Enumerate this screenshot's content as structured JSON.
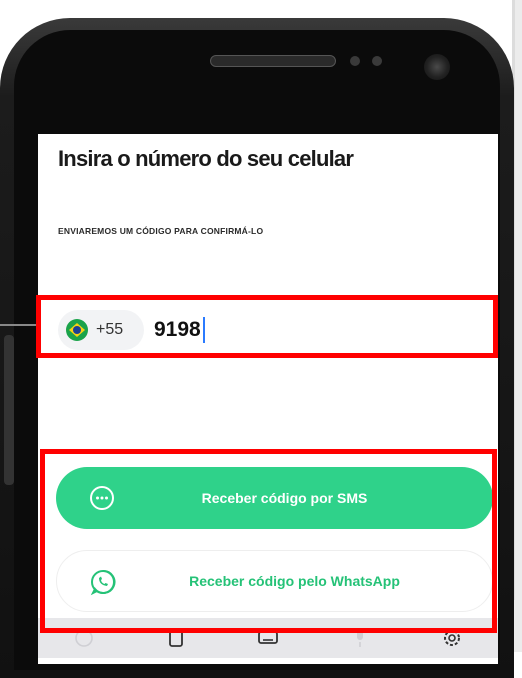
{
  "screen": {
    "title": "Insira o número do seu celular",
    "subtitle": "ENVIAREMOS UM CÓDIGO PARA CONFIRMÁ-LO"
  },
  "phone_input": {
    "country_icon": "brazil-flag-icon",
    "dial_code": "+55",
    "value": "9198"
  },
  "buttons": {
    "sms": {
      "label": "Receber código por SMS",
      "icon": "chat-bubble-icon"
    },
    "whatsapp": {
      "label": "Receber código pelo WhatsApp",
      "icon": "whatsapp-icon"
    }
  },
  "keyboard_toolbar": {
    "icons": [
      "emoji-icon",
      "clipboard-icon",
      "keyboard-icon",
      "microphone-icon",
      "gear-icon"
    ]
  },
  "colors": {
    "accent_green": "#2fd28a",
    "whatsapp_green": "#25c277",
    "highlight_red": "#ff0000"
  }
}
